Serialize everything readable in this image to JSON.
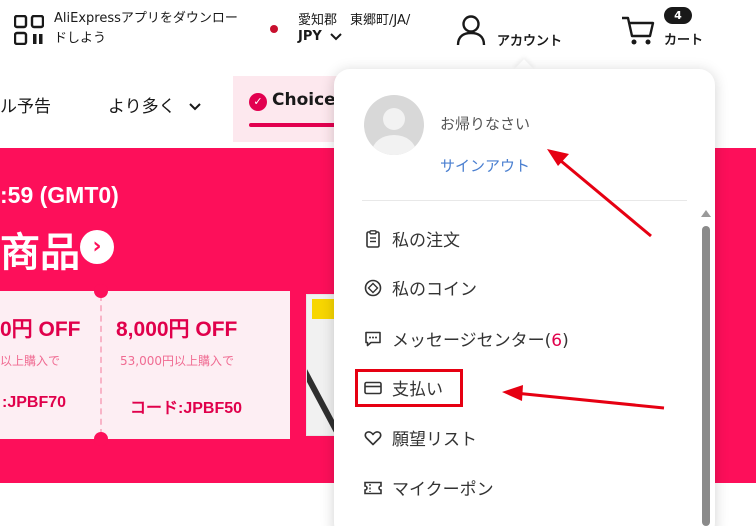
{
  "header": {
    "app_promo": "AliExpressアプリをダウンロードしよう",
    "location": "愛知郡　東郷町/JA/",
    "currency": "JPY",
    "account_label": "アカウント",
    "cart_count": "4",
    "cart_label": "カート"
  },
  "nav": {
    "item_1": "ル予告",
    "item_2": "より多く",
    "choice": "Choice"
  },
  "banner": {
    "countdown": ":59 (GMT0)",
    "title": "商品",
    "coupons": [
      {
        "amount": "0円 OFF",
        "condition": "以上購入で",
        "code": ":JPBF70"
      },
      {
        "amount": "8,000円 OFF",
        "condition": "53,000円以上購入で",
        "code": "コード:JPBF50"
      }
    ]
  },
  "dropdown": {
    "greeting": "お帰りなさい",
    "signout": "サインアウト",
    "menu": [
      {
        "label": "私の注文",
        "icon": "order-icon"
      },
      {
        "label": "私のコイン",
        "icon": "coin-icon"
      },
      {
        "label": "メッセージセンター(",
        "count": "6",
        "suffix": ")",
        "icon": "message-icon"
      },
      {
        "label": "支払い",
        "icon": "payment-card-icon"
      },
      {
        "label": "願望リスト",
        "icon": "heart-icon"
      },
      {
        "label": "マイクーポン",
        "icon": "coupon-icon"
      }
    ]
  },
  "colors": {
    "brand_pink": "#fd0f5a",
    "choice_accent": "#e2004f",
    "link_blue": "#4a7fd0",
    "annotation_red": "#e60012"
  }
}
